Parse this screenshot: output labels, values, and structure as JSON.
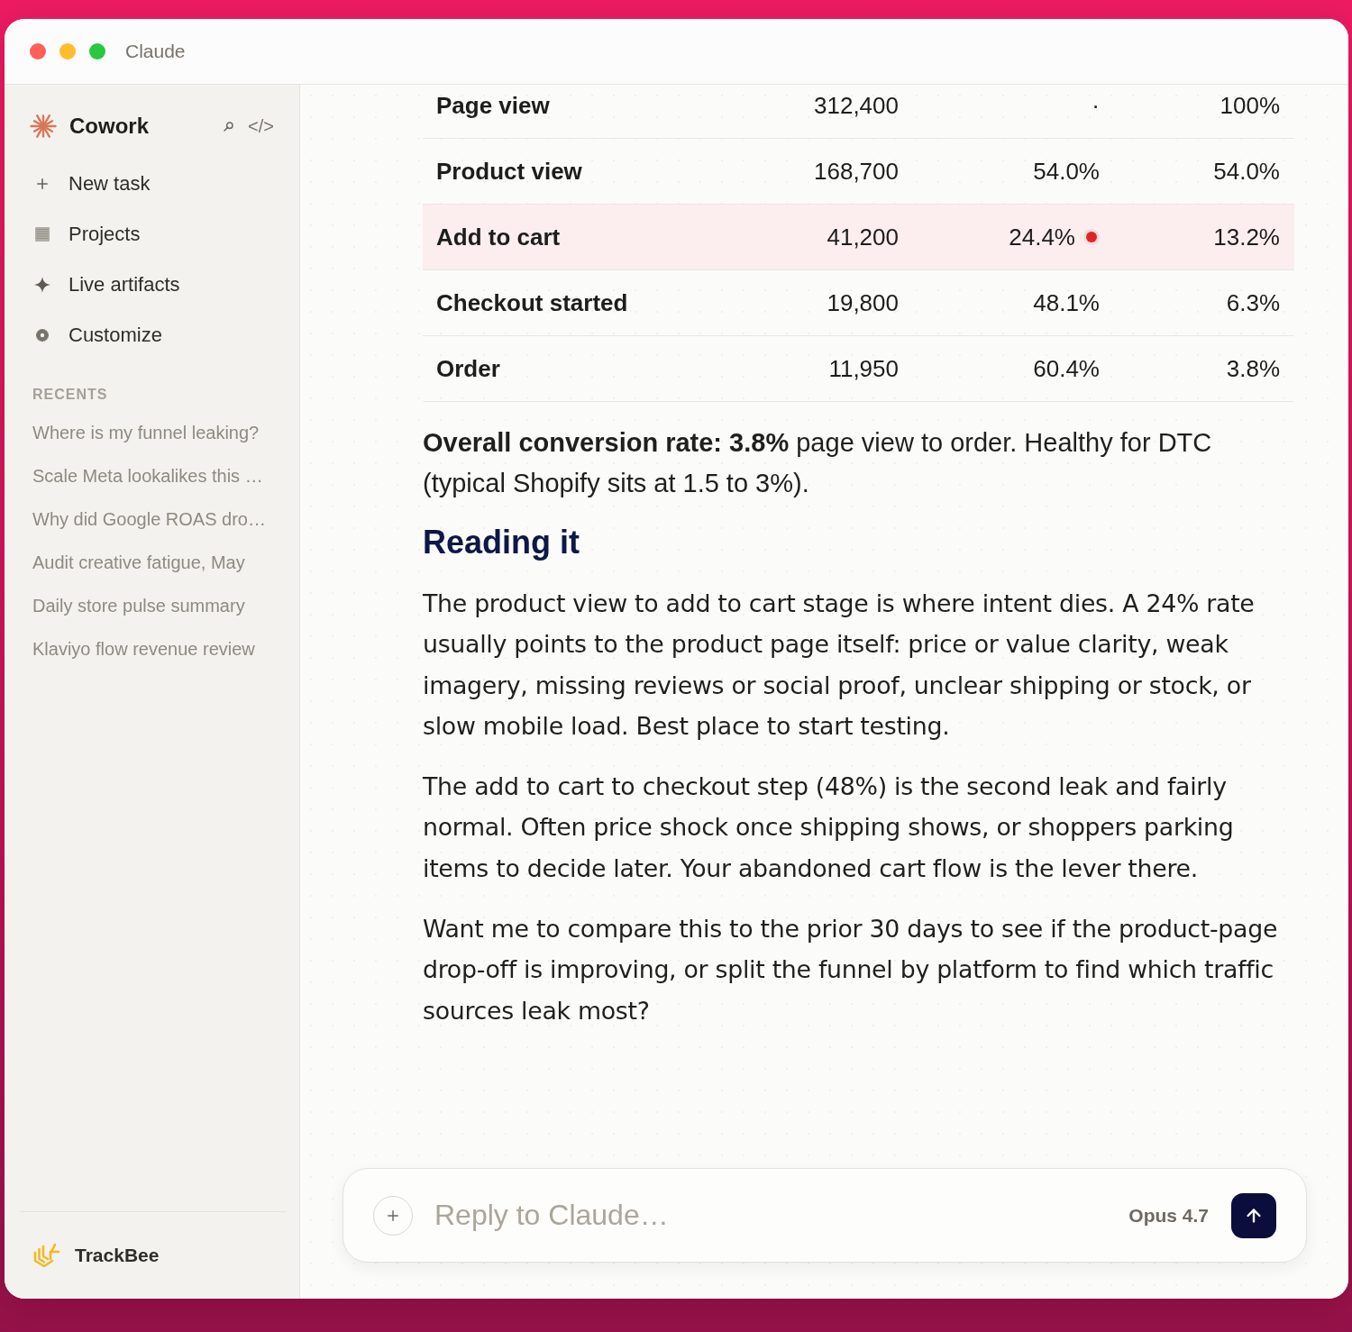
{
  "window": {
    "title": "Claude"
  },
  "sidebar": {
    "brand": "Cowork",
    "code_label": "</>",
    "nav": [
      {
        "label": "New task"
      },
      {
        "label": "Projects"
      },
      {
        "label": "Live artifacts"
      },
      {
        "label": "Customize"
      }
    ],
    "recents_heading": "RECENTS",
    "recents": [
      {
        "label": "Where is my funnel leaking?"
      },
      {
        "label": "Scale Meta lookalikes this …"
      },
      {
        "label": "Why did Google ROAS dro…"
      },
      {
        "label": "Audit creative fatigue, May"
      },
      {
        "label": "Daily store pulse summary"
      },
      {
        "label": "Klaviyo flow revenue review"
      }
    ],
    "workspace": "TrackBee"
  },
  "table": {
    "rows": [
      {
        "cells": [
          "Page view",
          "312,400",
          "·",
          "100%"
        ],
        "highlighted": false,
        "alert": false
      },
      {
        "cells": [
          "Product view",
          "168,700",
          "54.0%",
          "54.0%"
        ],
        "highlighted": false,
        "alert": false
      },
      {
        "cells": [
          "Add to cart",
          "41,200",
          "24.4%",
          "13.2%"
        ],
        "highlighted": true,
        "alert": true
      },
      {
        "cells": [
          "Checkout started",
          "19,800",
          "48.1%",
          "6.3%"
        ],
        "highlighted": false,
        "alert": false
      },
      {
        "cells": [
          "Order",
          "11,950",
          "60.4%",
          "3.8%"
        ],
        "highlighted": false,
        "alert": false
      }
    ]
  },
  "message": {
    "summary": "**Overall conversion rate: 3.8%** page view to order. Healthy for DTC (typical Shopify sits at 1.5 to 3%).",
    "heading": "Reading it",
    "paragraphs": [
      "The product view to add to cart stage is where intent dies. A 24% rate usually points to the product page itself: price or value clarity, weak imagery, missing reviews or social proof, unclear shipping or stock, or slow mobile load. Best place to start testing.",
      "The add to cart to checkout step (48%) is the second leak and fairly normal. Often price shock once shipping shows, or shoppers parking items to decide later. Your abandoned cart flow is the lever there.",
      "Want me to compare this to the prior 30 days to see if the product-page drop-off is improving, or split the funnel by platform to find which traffic sources leak most?"
    ]
  },
  "composer": {
    "placeholder": "Reply to Claude…",
    "model": "Opus 4.7"
  }
}
